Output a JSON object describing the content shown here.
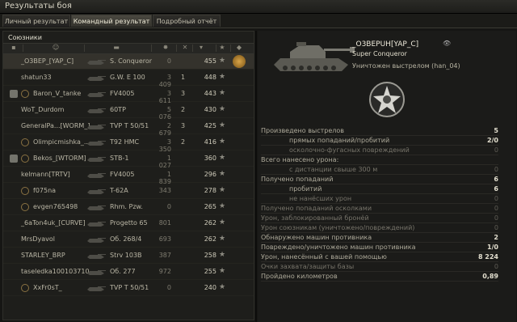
{
  "window": {
    "title": "Результаты боя"
  },
  "tabs": [
    {
      "label": "Личный результат",
      "active": false
    },
    {
      "label": "Командный результат",
      "active": true
    },
    {
      "label": "Подробный отчёт",
      "active": false
    }
  ],
  "team": {
    "label": "Союзники"
  },
  "columns": [
    "clan-icon",
    "name",
    "tank",
    "damage",
    "frags",
    "xp",
    "mastery-star"
  ],
  "players": [
    {
      "nick": "_O3BEP_[YAP_C]",
      "tank": "S. Conqueror",
      "damage": "0",
      "frags": "",
      "xp": "455",
      "clan": false,
      "medal": true
    },
    {
      "nick": "shatun33",
      "tank": "G.W. E 100",
      "damage": "3 409",
      "frags": "1",
      "xp": "448",
      "clan": false
    },
    {
      "nick": "Baron_V_tanke",
      "tank": "FV4005",
      "damage": "3 611",
      "frags": "3",
      "xp": "443",
      "clan": true,
      "pico": true
    },
    {
      "nick": "WoT_Durdom",
      "tank": "60TP",
      "damage": "5 076",
      "frags": "2",
      "xp": "430",
      "clan": false
    },
    {
      "nick": "GeneralPa...[WORM_]",
      "tank": "TVP T 50/51",
      "damage": "2 679",
      "frags": "3",
      "xp": "425",
      "clan": false
    },
    {
      "nick": "Olimpicmishka_...",
      "tank": "T92 HMC",
      "damage": "3 350",
      "frags": "2",
      "xp": "416",
      "clan": false,
      "pico": true
    },
    {
      "nick": "Bekos_[WTORM]",
      "tank": "STB-1",
      "damage": "1 027",
      "frags": "",
      "xp": "360",
      "clan": true,
      "pico": true
    },
    {
      "nick": "kelmann[TRTV]",
      "tank": "FV4005",
      "damage": "1 839",
      "frags": "",
      "xp": "296",
      "clan": false
    },
    {
      "nick": "f075na",
      "tank": "T-62A",
      "damage": "343",
      "frags": "",
      "xp": "278",
      "clan": false,
      "pico": true
    },
    {
      "nick": "evgen765498",
      "tank": "Rhm. Pzw.",
      "damage": "0",
      "frags": "",
      "xp": "265",
      "clan": false,
      "pico": true
    },
    {
      "nick": "_6aTon4uk_[CURVE]",
      "tank": "Progetto 65",
      "damage": "801",
      "frags": "",
      "xp": "262",
      "clan": false
    },
    {
      "nick": "MrsDyavol",
      "tank": "Об. 268/4",
      "damage": "693",
      "frags": "",
      "xp": "262",
      "clan": false
    },
    {
      "nick": "STARLEY_BRP",
      "tank": "Strv 103B",
      "damage": "387",
      "frags": "",
      "xp": "258",
      "clan": false
    },
    {
      "nick": "taseledka100103710",
      "tank": "Об. 277",
      "damage": "972",
      "frags": "",
      "xp": "255",
      "clan": false
    },
    {
      "nick": "XxFr0sT_",
      "tank": "TVP T 50/51",
      "damage": "0",
      "frags": "",
      "xp": "240",
      "clan": false,
      "pico": true
    }
  ],
  "detail": {
    "player": "_O3BEPUH[YAP_C]",
    "tank": "Super Conqueror",
    "status": "Уничтожен выстрелом (han_04)",
    "stats": [
      {
        "label": "Произведено выстрелов",
        "value": "5",
        "sub": false,
        "dim": false
      },
      {
        "label": "прямых попаданий/пробитий",
        "value": "2/0",
        "sub": true,
        "dim": false
      },
      {
        "label": "осколочно-фугасных повреждений",
        "value": "0",
        "sub": true,
        "dim": true
      },
      {
        "label": "Всего нанесено урона:",
        "value": "",
        "sub": false,
        "dim": false
      },
      {
        "label": "с дистанции свыше 300 м",
        "value": "0",
        "sub": true,
        "dim": true
      },
      {
        "label": "Получено попаданий",
        "value": "6",
        "sub": false,
        "dim": false
      },
      {
        "label": "пробитий",
        "value": "6",
        "sub": true,
        "dim": false
      },
      {
        "label": "не нанёсших урон",
        "value": "0",
        "sub": true,
        "dim": true
      },
      {
        "label": "Получено попаданий осколками",
        "value": "0",
        "sub": false,
        "dim": true
      },
      {
        "label": "Урон, заблокированный бронёй",
        "value": "0",
        "sub": false,
        "dim": true
      },
      {
        "label": "Урон союзникам (уничтожено/повреждений)",
        "value": "0",
        "sub": false,
        "dim": true
      },
      {
        "label": "Обнаружено машин противника",
        "value": "2",
        "sub": false,
        "dim": false
      },
      {
        "label": "Повреждено/уничтожено машин противника",
        "value": "1/0",
        "sub": false,
        "dim": false
      },
      {
        "label": "Урон, нанесённый с вашей помощью",
        "value": "8 224",
        "sub": false,
        "dim": false
      },
      {
        "label": "Очки захвата/защиты базы",
        "value": "0",
        "sub": false,
        "dim": true
      },
      {
        "label": "Пройдено километров",
        "value": "0,89",
        "sub": false,
        "dim": false
      }
    ]
  }
}
